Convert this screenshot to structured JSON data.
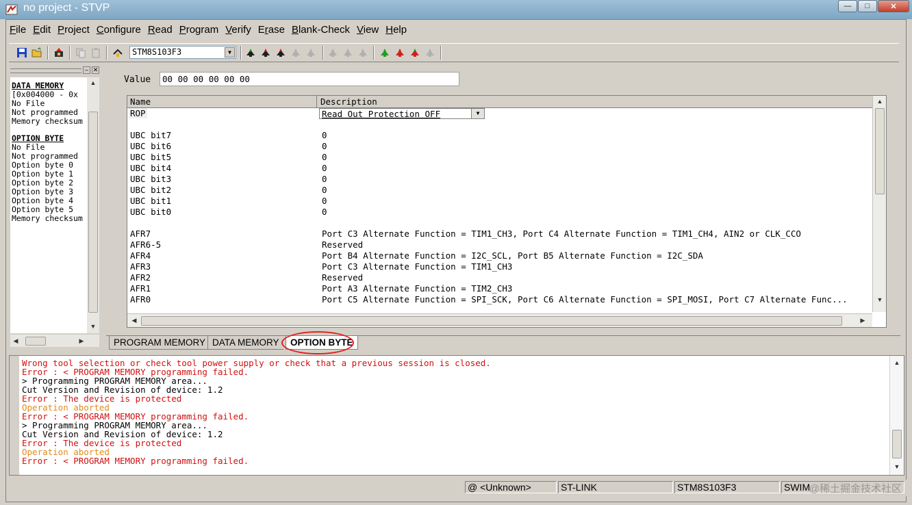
{
  "window": {
    "title": "no project - STVP"
  },
  "menu": [
    {
      "key": "F",
      "rest": "ile"
    },
    {
      "key": "E",
      "rest": "dit"
    },
    {
      "key": "P",
      "rest": "roject"
    },
    {
      "key": "C",
      "rest": "onfigure"
    },
    {
      "key": "R",
      "rest": "ead"
    },
    {
      "key": "P",
      "rest": "rogram"
    },
    {
      "key": "V",
      "rest": "erify"
    },
    {
      "pre": "E",
      "key": "r",
      "rest": "ase"
    },
    {
      "key": "B",
      "rest": "lank-Check"
    },
    {
      "key": "V",
      "rest": "iew"
    },
    {
      "key": "H",
      "rest": "elp"
    }
  ],
  "toolbar": {
    "device": "STM8S103F3"
  },
  "left_panel": {
    "data_memory": {
      "heading": "DATA MEMORY",
      "lines": [
        "[0x004000 - 0x",
        "No File",
        "Not programmed",
        "Memory checksum"
      ]
    },
    "option_byte": {
      "heading": "OPTION BYTE",
      "lines": [
        "No File",
        "Not programmed",
        "Option byte 0",
        "Option byte 1",
        "Option byte 2",
        "Option byte 3",
        "Option byte 4",
        "Option byte 5",
        "Memory checksum"
      ]
    }
  },
  "editor": {
    "value_label": "Value",
    "value": "00 00 00 00 00 00",
    "col_name": "Name",
    "col_description": "Description",
    "rop": {
      "name": "ROP",
      "value": "Read Out Protection OFF"
    },
    "rows": [
      {
        "name": "UBC bit7",
        "desc": "0"
      },
      {
        "name": "UBC bit6",
        "desc": "0"
      },
      {
        "name": "UBC bit5",
        "desc": "0"
      },
      {
        "name": "UBC bit4",
        "desc": "0"
      },
      {
        "name": "UBC bit3",
        "desc": "0"
      },
      {
        "name": "UBC bit2",
        "desc": "0"
      },
      {
        "name": "UBC bit1",
        "desc": "0"
      },
      {
        "name": "UBC bit0",
        "desc": "0"
      },
      {
        "name": "",
        "desc": ""
      },
      {
        "name": "AFR7",
        "desc": "Port C3 Alternate Function = TIM1_CH3, Port C4 Alternate Function = TIM1_CH4, AIN2 or CLK_CCO"
      },
      {
        "name": "AFR6-5",
        "desc": "Reserved"
      },
      {
        "name": "AFR4",
        "desc": "Port B4 Alternate Function = I2C_SCL, Port B5 Alternate Function = I2C_SDA"
      },
      {
        "name": "AFR3",
        "desc": "Port C3 Alternate Function = TIM1_CH3"
      },
      {
        "name": "AFR2",
        "desc": "Reserved"
      },
      {
        "name": "AFR1",
        "desc": "Port A3 Alternate Function = TIM2_CH3"
      },
      {
        "name": "AFR0",
        "desc": "Port C5 Alternate Function = SPI_SCK, Port C6 Alternate Function = SPI_MOSI, Port C7 Alternate Func..."
      }
    ]
  },
  "tabs": [
    "PROGRAM MEMORY",
    "DATA MEMORY",
    "OPTION BYTE"
  ],
  "output": [
    {
      "type": "red",
      "text": "Wrong tool selection or check tool power supply or check that a previous session is closed."
    },
    {
      "type": "red",
      "text": "Error : < PROGRAM MEMORY programming failed."
    },
    {
      "type": "black",
      "text": "> Programming  PROGRAM MEMORY area..."
    },
    {
      "type": "black",
      "text": "Cut Version and Revision of device: 1.2"
    },
    {
      "type": "red",
      "text": "Error : The device is protected"
    },
    {
      "type": "orange",
      "text": "Operation aborted"
    },
    {
      "type": "red",
      "text": "Error : < PROGRAM MEMORY programming failed."
    },
    {
      "type": "black",
      "text": "> Programming  PROGRAM MEMORY area..."
    },
    {
      "type": "black",
      "text": "Cut Version and Revision of device: 1.2"
    },
    {
      "type": "red",
      "text": "Error : The device is protected"
    },
    {
      "type": "orange",
      "text": "Operation aborted"
    },
    {
      "type": "red",
      "text": "Error : < PROGRAM MEMORY programming failed."
    }
  ],
  "status": {
    "connection": "@ <Unknown>",
    "tool": "ST-LINK",
    "device": "STM8S103F3",
    "protocol": "SWIM"
  },
  "watermark": "@稀土掘金技术社区",
  "colors": {
    "error": "#d01010",
    "warning": "#e08c20",
    "highlight_circle": "#e02020"
  }
}
